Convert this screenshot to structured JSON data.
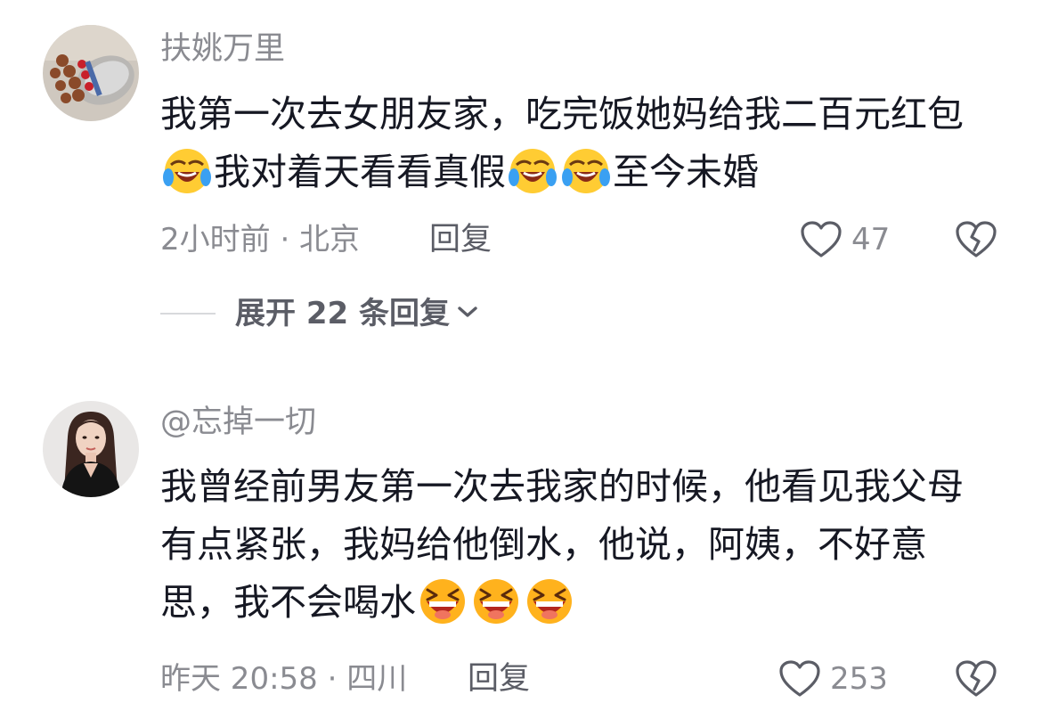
{
  "comments": [
    {
      "username": "扶姚万里",
      "text_parts": [
        "我第一次去女朋友家，吃完饭她妈给我二百元红包",
        "我对着天看看真假",
        "至今未婚"
      ],
      "emoji": "laughing-tears-emoji",
      "meta": "2小时前 · 北京",
      "reply_label": "回复",
      "like_count": "47"
    },
    {
      "username": "@忘掉一切",
      "text_parts": [
        "我曾经前男友第一次去我家的时候，他看见我父母有点紧张，我妈给他倒水，他说，阿姨，不好意思，我不会喝水"
      ],
      "emoji": "grinning-squint-emoji",
      "meta": "昨天 20:58 · 四川",
      "reply_label": "回复",
      "like_count": "253"
    }
  ],
  "expand_replies": {
    "label": "展开 22 条回复"
  },
  "icons": {
    "like": "heart-outline-icon",
    "dislike": "broken-heart-icon",
    "expand": "chevron-down-icon"
  }
}
